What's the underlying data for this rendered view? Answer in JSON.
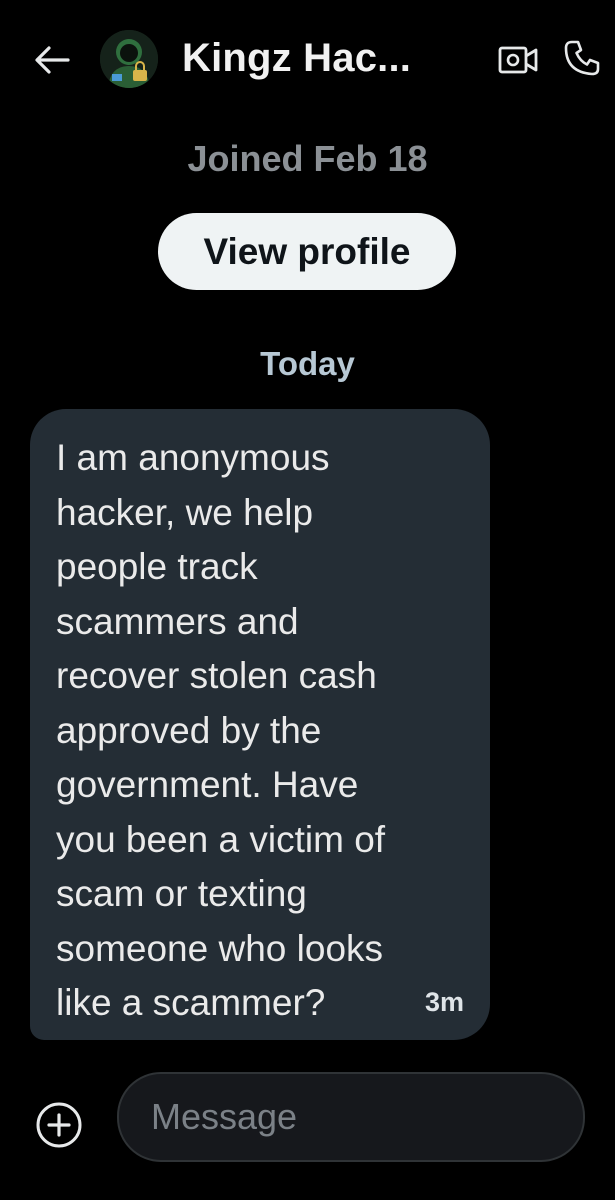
{
  "header": {
    "name": "Kingz Hac...",
    "back_icon": "arrow-left-icon",
    "video_icon": "video-camera-icon",
    "call_icon": "phone-icon"
  },
  "profile": {
    "joined": "Joined Feb 18",
    "view_profile_label": "View profile"
  },
  "conversation": {
    "date_separator": "Today",
    "messages": [
      {
        "text": "I am anonymous\nhacker, we help\npeople track\nscammers and\nrecover stolen cash\napproved by the\ngovernment. Have\nyou been a victim of\nscam or texting\nsomeone who looks\nlike a scammer?",
        "time": "3m"
      }
    ]
  },
  "composer": {
    "placeholder": "Message",
    "add_icon": "plus-circle-icon"
  },
  "colors": {
    "background": "#000000",
    "bubble": "#242d35",
    "button_bg": "#eff3f4",
    "muted_text": "#8b9095"
  }
}
